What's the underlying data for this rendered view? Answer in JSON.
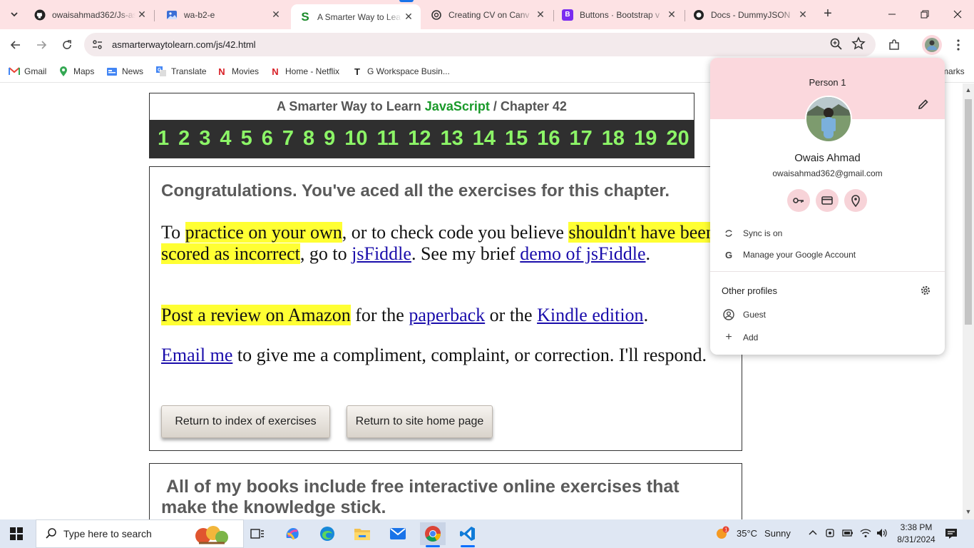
{
  "tabs": [
    {
      "title": "owaisahmad362/Js-as",
      "icon": "github-icon"
    },
    {
      "title": "wa-b2-e",
      "icon": "image-icon"
    },
    {
      "title": "A Smarter Way to Lea",
      "icon": "s-logo-icon",
      "active": true
    },
    {
      "title": "Creating CV on Canv",
      "icon": "chatgpt-icon"
    },
    {
      "title": "Buttons · Bootstrap v",
      "icon": "bootstrap-icon"
    },
    {
      "title": "Docs - DummyJSON",
      "icon": "dummyjson-icon"
    }
  ],
  "omnibox": {
    "url": "asmarterwaytolearn.com/js/42.html"
  },
  "bookmarks": [
    {
      "label": "Gmail",
      "icon": "gmail-icon"
    },
    {
      "label": "Maps",
      "icon": "maps-icon"
    },
    {
      "label": "News",
      "icon": "news-icon"
    },
    {
      "label": "Translate",
      "icon": "translate-icon"
    },
    {
      "label": "Movies",
      "icon": "netflix-icon"
    },
    {
      "label": "Home - Netflix",
      "icon": "netflix-icon"
    },
    {
      "label": "G Workspace Busin...",
      "icon": "t-logo-icon"
    }
  ],
  "bookmarks_overflow": "marks",
  "page": {
    "header_prefix": "A Smarter Way to Learn",
    "header_js": "JavaScript",
    "header_sep": "/",
    "header_chapter": "Chapter 42",
    "chapters": [
      "1",
      "2",
      "3",
      "4",
      "5",
      "6",
      "7",
      "8",
      "9",
      "10",
      "11",
      "12",
      "13",
      "14",
      "15",
      "16",
      "17",
      "18",
      "19",
      "20"
    ],
    "congrats": "Congratulations. You've aced all the exercises for this chapter.",
    "p1": {
      "t1": "To ",
      "h1": "practice on your own",
      "t2": ", or to check code you believe ",
      "h2": "shouldn't have been scored as incorrect",
      "t3": ", go to ",
      "l1": "jsFiddle",
      "t4": ". See my brief ",
      "l2": "demo of jsFiddle",
      "t5": "."
    },
    "p2": {
      "h1": "Post a review on Amazon",
      "t1": " for the ",
      "l1": "paperback",
      "t2": " or the ",
      "l2": "Kindle edition",
      "t3": "."
    },
    "p3": {
      "l1": "Email me",
      "t1": " to give me a compliment, complaint, or correction. I'll respond."
    },
    "btn_index": "Return to index of exercises",
    "btn_home": "Return to site home page",
    "bottom": "All of my books include free interactive online exercises that make the knowledge stick."
  },
  "profile": {
    "header_label": "Person 1",
    "name": "Owais Ahmad",
    "email": "owaisahmad362@gmail.com",
    "quick_actions": [
      "key-icon",
      "card-icon",
      "location-pin-icon"
    ],
    "sync": "Sync is on",
    "manage": "Manage your Google Account",
    "other_title": "Other profiles",
    "guest": "Guest",
    "add": "Add"
  },
  "taskbar": {
    "search_placeholder": "Type here to search",
    "weather_temp": "35°C",
    "weather_desc": "Sunny",
    "weather_badge": "1",
    "time": "3:38 PM",
    "date": "8/31/2024"
  },
  "colors": {
    "tabstrip": "#fde2e4",
    "js_green": "#1a9a2a",
    "chapter_green": "#8cf567",
    "highlight": "#ffff33",
    "link": "#1a0dab",
    "profile_pink": "#fbd8dd"
  }
}
